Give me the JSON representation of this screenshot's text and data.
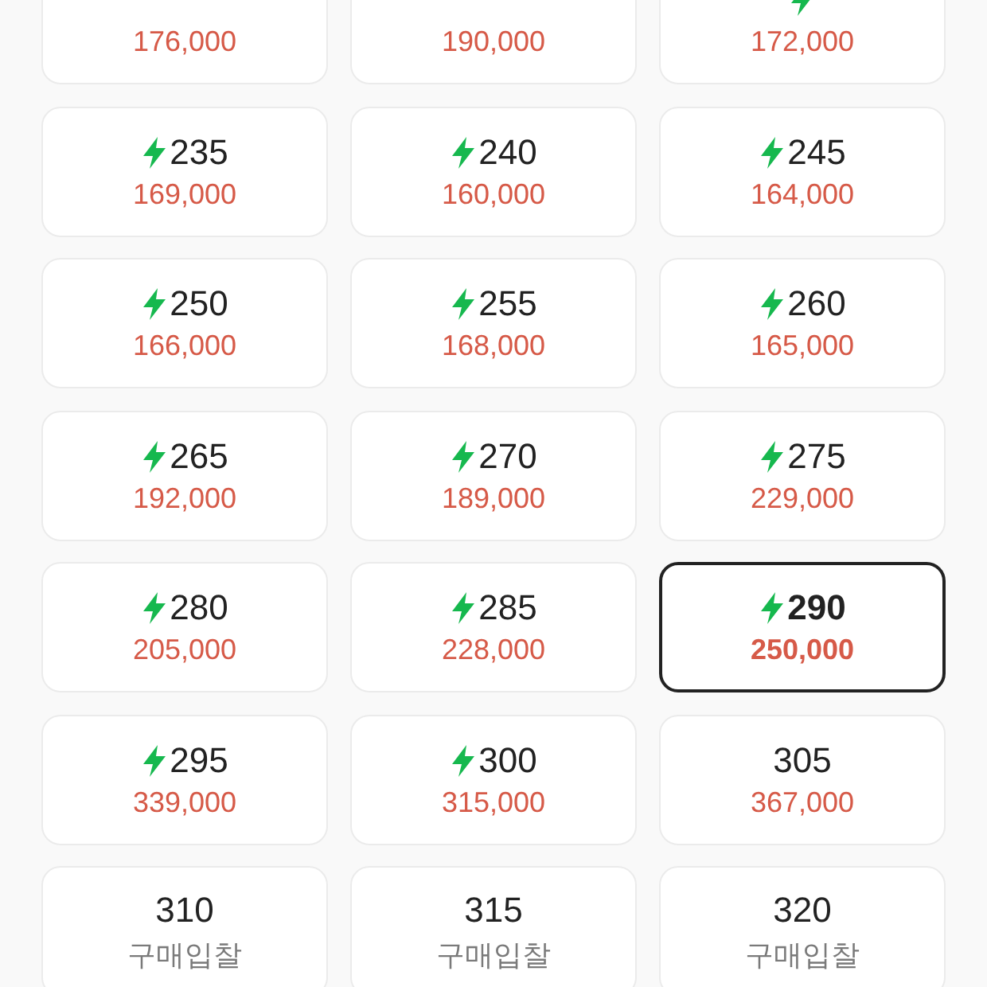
{
  "sizes": [
    {
      "price": "176,000",
      "kind": "price",
      "fast": false,
      "selected": false
    },
    {
      "price": "190,000",
      "kind": "price",
      "fast": false,
      "selected": false
    },
    {
      "price": "172,000",
      "kind": "price",
      "fast": true,
      "selected": false
    },
    {
      "size": "235",
      "price": "169,000",
      "kind": "price",
      "fast": true,
      "selected": false
    },
    {
      "size": "240",
      "price": "160,000",
      "kind": "price",
      "fast": true,
      "selected": false
    },
    {
      "size": "245",
      "price": "164,000",
      "kind": "price",
      "fast": true,
      "selected": false
    },
    {
      "size": "250",
      "price": "166,000",
      "kind": "price",
      "fast": true,
      "selected": false
    },
    {
      "size": "255",
      "price": "168,000",
      "kind": "price",
      "fast": true,
      "selected": false
    },
    {
      "size": "260",
      "price": "165,000",
      "kind": "price",
      "fast": true,
      "selected": false
    },
    {
      "size": "265",
      "price": "192,000",
      "kind": "price",
      "fast": true,
      "selected": false
    },
    {
      "size": "270",
      "price": "189,000",
      "kind": "price",
      "fast": true,
      "selected": false
    },
    {
      "size": "275",
      "price": "229,000",
      "kind": "price",
      "fast": true,
      "selected": false
    },
    {
      "size": "280",
      "price": "205,000",
      "kind": "price",
      "fast": true,
      "selected": false
    },
    {
      "size": "285",
      "price": "228,000",
      "kind": "price",
      "fast": true,
      "selected": false
    },
    {
      "size": "290",
      "price": "250,000",
      "kind": "price",
      "fast": true,
      "selected": true
    },
    {
      "size": "295",
      "price": "339,000",
      "kind": "price",
      "fast": true,
      "selected": false
    },
    {
      "size": "300",
      "price": "315,000",
      "kind": "price",
      "fast": true,
      "selected": false
    },
    {
      "size": "305",
      "price": "367,000",
      "kind": "price",
      "fast": false,
      "selected": false
    },
    {
      "size": "310",
      "price": "구매입찰",
      "kind": "bid",
      "fast": false,
      "selected": false
    },
    {
      "size": "315",
      "price": "구매입찰",
      "kind": "bid",
      "fast": false,
      "selected": false
    },
    {
      "size": "320",
      "price": "구매입찰",
      "kind": "bid",
      "fast": false,
      "selected": false
    }
  ]
}
